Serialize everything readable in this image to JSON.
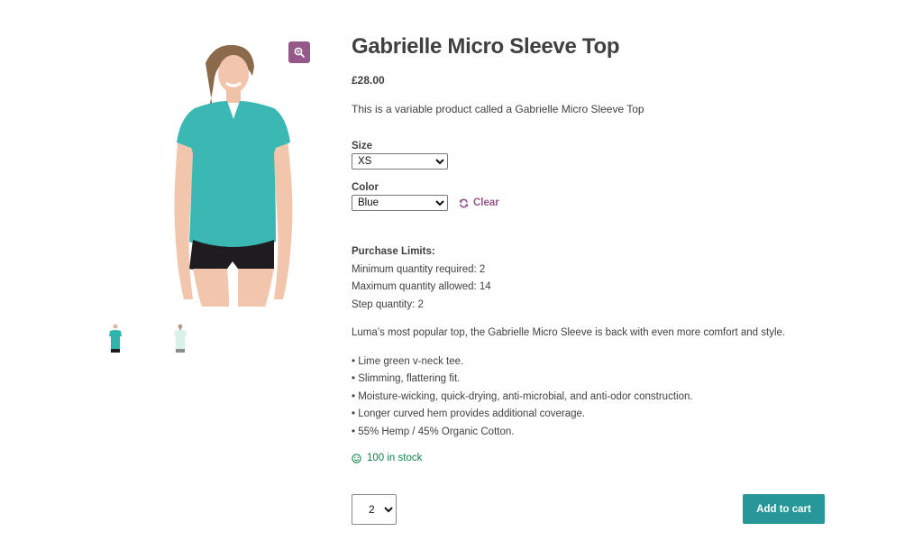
{
  "product": {
    "title": "Gabrielle Micro Sleeve Top",
    "price": "£28.00",
    "short_description": "This is a variable product called a Gabrielle Micro Sleeve Top",
    "main_image_alt": "Woman wearing teal v-neck micro sleeve top",
    "thumbnails": [
      {
        "alt": "Front view teal top"
      },
      {
        "alt": "Back view light mint top"
      }
    ]
  },
  "icons": {
    "zoom": "magnifier-zoom-icon",
    "clear": "refresh-icon",
    "stock": "smiley-icon"
  },
  "variations": {
    "size": {
      "label": "Size",
      "selected": "XS",
      "options": [
        "XS"
      ]
    },
    "color": {
      "label": "Color",
      "selected": "Blue",
      "options": [
        "Blue"
      ]
    },
    "clear_label": "Clear"
  },
  "purchase_limits": {
    "heading": "Purchase Limits:",
    "min": "Minimum quantity required: 2",
    "max": "Maximum quantity allowed: 14",
    "step": "Step quantity: 2"
  },
  "description": "Luma’s most popular top, the Gabrielle Micro Sleeve is back with even more comfort and style.",
  "features": [
    "• Lime green v-neck tee.",
    "• Slimming, flattering fit.",
    "• Moisture-wicking, quick-drying, anti-microbial, and anti-odor construction.",
    "• Longer curved hem provides additional coverage.",
    "• 55% Hemp / 45% Organic Cotton."
  ],
  "stock": "100 in stock",
  "cart": {
    "quantity": "2",
    "add_label": "Add to cart"
  },
  "colors": {
    "accent": "#96588a",
    "button": "#27979a",
    "stock": "#0f834d",
    "text": "#404040"
  }
}
